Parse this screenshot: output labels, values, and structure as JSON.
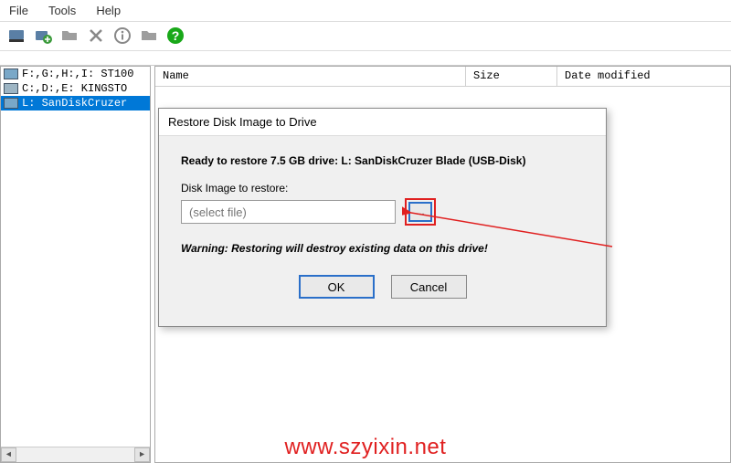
{
  "menu": {
    "file": "File",
    "tools": "Tools",
    "help": "Help"
  },
  "tree": {
    "items": [
      {
        "label": "F:,G:,H:,I: ST100"
      },
      {
        "label": "C:,D:,E: KINGSTO"
      },
      {
        "label": "L: SanDiskCruzer"
      }
    ]
  },
  "list": {
    "col_name": "Name",
    "col_size": "Size",
    "col_date": "Date modified"
  },
  "dialog": {
    "title": "Restore Disk Image to Drive",
    "ready": "Ready to restore 7.5 GB drive: L: SanDiskCruzer Blade (USB-Disk)",
    "label": "Disk Image to restore:",
    "placeholder": "(select file)",
    "browse": "...",
    "warning": "Warning: Restoring will destroy existing data on this drive!",
    "ok": "OK",
    "cancel": "Cancel"
  },
  "watermark": {
    "url": "www.szyixin.net",
    "bg": "http://www.szyixin.net"
  }
}
